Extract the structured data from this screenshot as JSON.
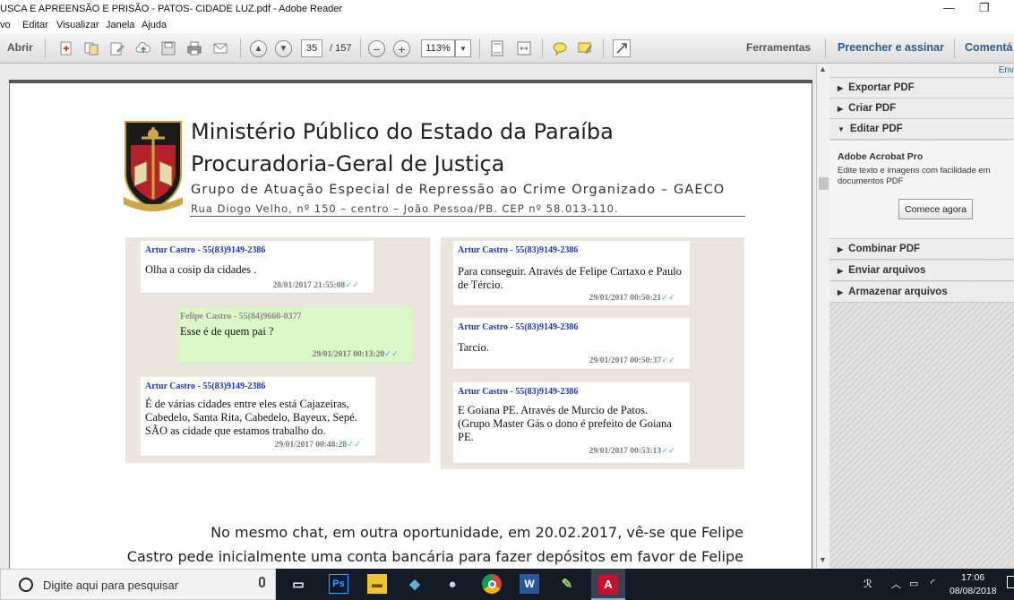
{
  "window": {
    "title": "USCA E APREENSÃO E PRISÃO - PATOS- CIDADE LUZ.pdf - Adobe Reader",
    "minimize": "—",
    "restore": "❐"
  },
  "menu": [
    "vo",
    "Editar",
    "Visualizar",
    "Janela",
    "Ajuda"
  ],
  "toolbar": {
    "open_label": "Abrir",
    "page_current": "35",
    "page_total": "/ 157",
    "zoom": "113%",
    "tools_tab": "Ferramentas",
    "sign_tab": "Preencher e assinar",
    "comment_tab": "Comentá"
  },
  "sidebar": {
    "top_link": "Env",
    "sections": [
      {
        "label": "Exportar PDF",
        "expanded": false
      },
      {
        "label": "Criar PDF",
        "expanded": false
      },
      {
        "label": "Editar PDF",
        "expanded": true
      },
      {
        "label": "Combinar PDF",
        "expanded": false
      },
      {
        "label": "Enviar arquivos",
        "expanded": false
      },
      {
        "label": "Armazenar arquivos",
        "expanded": false
      }
    ],
    "edit_panel": {
      "product": "Adobe Acrobat Pro",
      "description": "Edite texto e imagens com facilidade em documentos PDF",
      "button": "Comece agora"
    }
  },
  "document": {
    "org_line1": "Ministério Público do Estado da Paraíba",
    "org_line2": "Procuradoria-Geral de Justiça",
    "org_line3": "Grupo de Atuação Especial de Repressão ao Crime Organizado – GAECO",
    "address": "Rua Diogo Velho, nº 150 – centro – João Pessoa/PB. CEP nº 58.013-110.",
    "paragraph_line1": "No mesmo chat, em outra oportunidade, em 20.02.2017, vê-se que Felipe",
    "paragraph_line2": "Castro pede inicialmente uma conta bancária para fazer depósitos em favor de Felipe"
  },
  "chat_left": [
    {
      "sender": "Artur Castro - 55(83)9149-2386",
      "text": "Olha a cosip da cidades .",
      "time": "28/01/2017 21:55:08"
    },
    {
      "sender": "Felipe Castro - 55(84)9660-0377",
      "text": "Esse é de quem pai ?",
      "time": "29/01/2017 00:13:20"
    },
    {
      "sender": "Artur Castro - 55(83)9149-2386",
      "text": "É de várias cidades entre eles está Cajazeiras, Cabedelo, Santa Rita, Cabedelo, Bayeux, Sepé. SÃO  as cidade que estamos trabalho do.",
      "time": "29/01/2017 00:48:28"
    }
  ],
  "chat_right": [
    {
      "sender": "Artur Castro - 55(83)9149-2386",
      "text": "Para conseguir. Através de Felipe Cartaxo  e Paulo de Tércio.",
      "time": "29/01/2017 00:50:21"
    },
    {
      "sender": "Artur Castro - 55(83)9149-2386",
      "text": "Tarcio.",
      "time": "29/01/2017 00:50:37"
    },
    {
      "sender": "Artur Castro - 55(83)9149-2386",
      "text": "E Goiana PE. Através de Murcio de Patos. (Grupo Master Gás o dono é  prefeito de Goiana PE.",
      "time": "29/01/2017 00:53:13"
    }
  ],
  "tick": "✓✓",
  "taskbar": {
    "search_placeholder": "Digite aqui para pesquisar",
    "time": "17:06",
    "date": "08/08/2018"
  },
  "colors": {
    "sender_blue": "#1c37b8",
    "tick_blue": "#4fb6e8",
    "chat_bg": "#ece5dd",
    "outgoing_bubble": "#dcf8c6",
    "tab_blue": "#2a5b8a"
  }
}
